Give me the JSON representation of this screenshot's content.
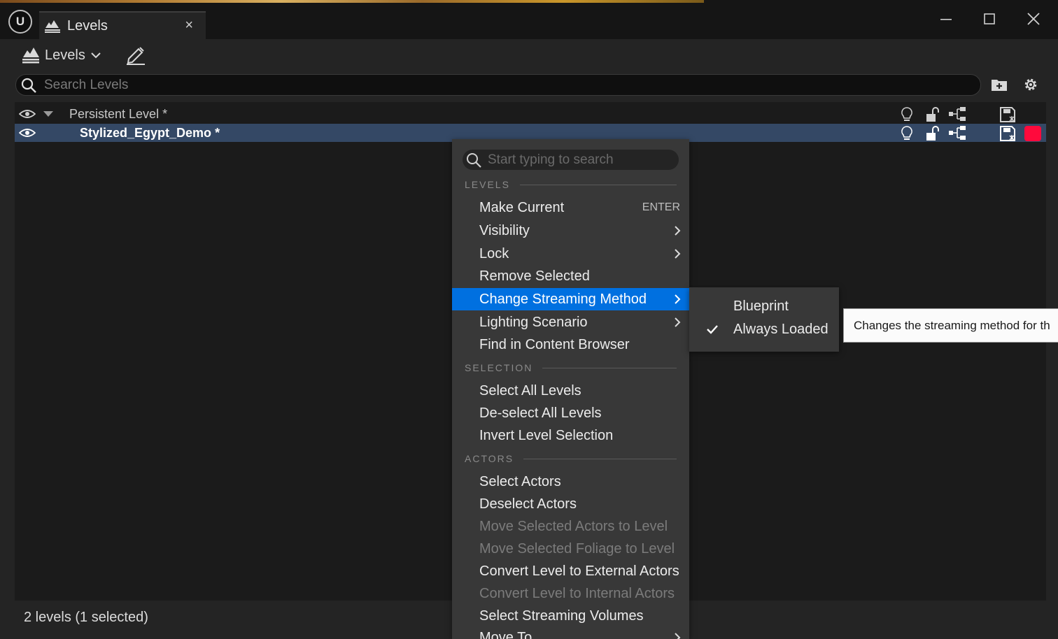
{
  "window": {
    "tab_title": "Levels",
    "tab_close": "×"
  },
  "toolbar": {
    "levels_dropdown": "Levels"
  },
  "search": {
    "placeholder": "Search Levels",
    "value": ""
  },
  "levels": [
    {
      "name": "Persistent Level",
      "dirty": "*"
    },
    {
      "name": "Stylized_Egypt_Demo",
      "dirty": "*",
      "selected": true,
      "color": "#ff0a3c"
    }
  ],
  "status": "2 levels (1 selected)",
  "context_menu": {
    "search_placeholder": "Start typing to search",
    "sections": {
      "levels": "LEVELS",
      "selection": "SELECTION",
      "actors": "ACTORS"
    },
    "items": {
      "make_current": "Make Current",
      "make_current_shortcut": "ENTER",
      "visibility": "Visibility",
      "lock": "Lock",
      "remove_selected": "Remove Selected",
      "change_streaming_method": "Change Streaming Method",
      "lighting_scenario": "Lighting Scenario",
      "find_in_content_browser": "Find in Content Browser",
      "select_all_levels": "Select All Levels",
      "deselect_all_levels": "De-select All Levels",
      "invert_level_selection": "Invert Level Selection",
      "select_actors": "Select Actors",
      "deselect_actors": "Deselect Actors",
      "move_actors_to_level": "Move Selected Actors to Level",
      "move_foliage_to_level": "Move Selected Foliage to Level",
      "convert_to_external": "Convert Level to External Actors",
      "convert_to_internal": "Convert Level to Internal Actors",
      "select_streaming_volumes": "Select Streaming Volumes",
      "move_to": "Move To"
    }
  },
  "submenu": {
    "blueprint": "Blueprint",
    "always_loaded": "Always Loaded",
    "checked": "Always Loaded"
  },
  "tooltip": "Changes the streaming method for th"
}
